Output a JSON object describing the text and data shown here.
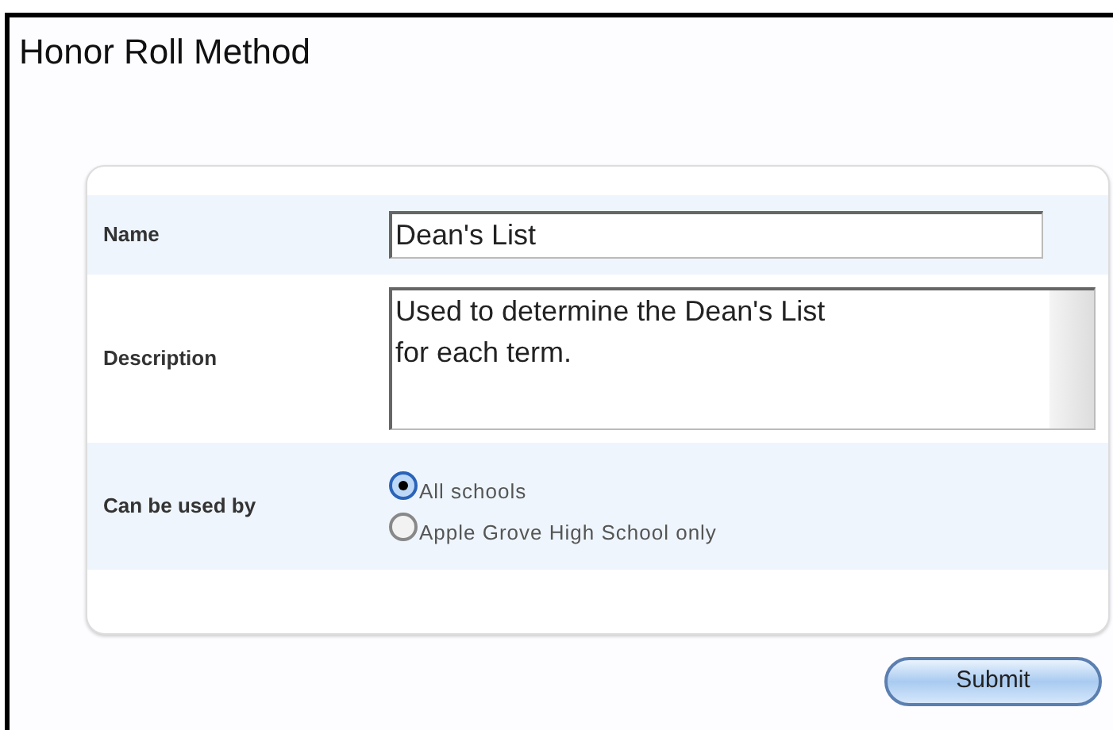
{
  "title": "Honor Roll Method",
  "fields": [
    {
      "label": "Name",
      "kind": "text",
      "value": "Dean's List"
    },
    {
      "label": "Description",
      "kind": "textarea",
      "value": "Used to determine the Dean's List\nfor each term."
    },
    {
      "label": "Can be used by",
      "kind": "radio",
      "options": [
        {
          "label": "All schools",
          "selected": true
        },
        {
          "label": "Apple Grove High School only",
          "selected": false
        }
      ]
    }
  ],
  "submit": "Submit"
}
